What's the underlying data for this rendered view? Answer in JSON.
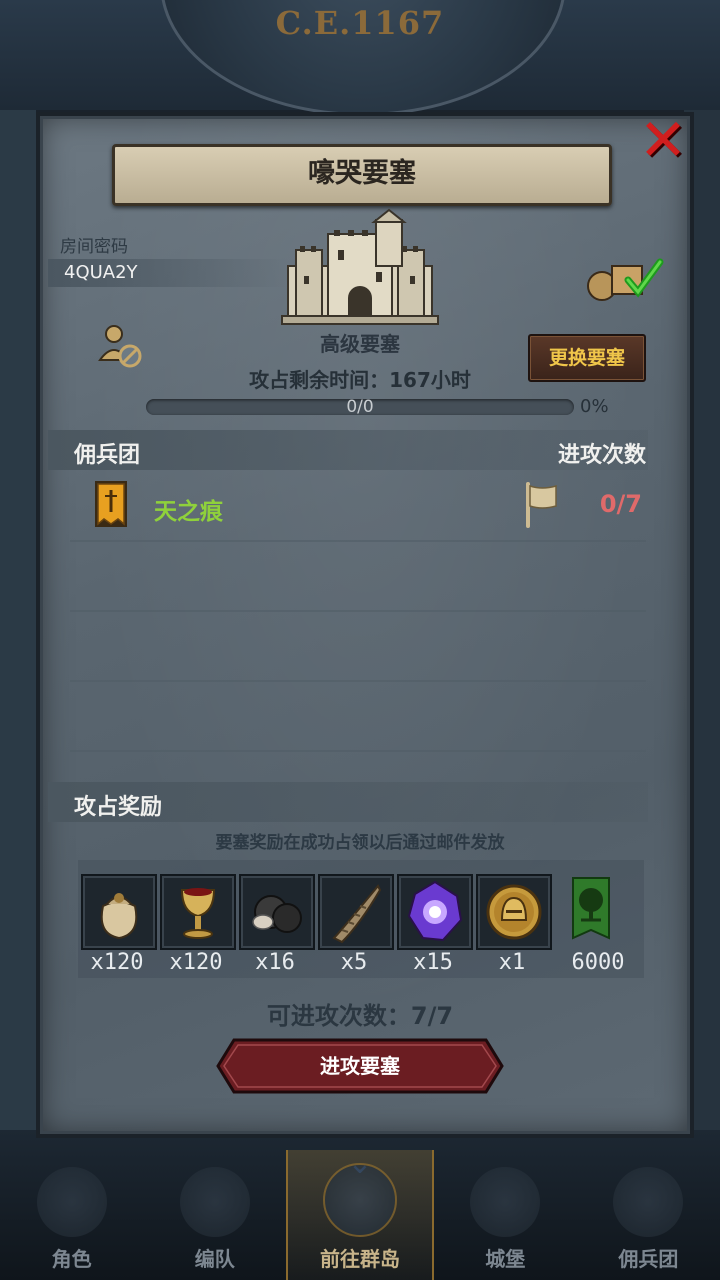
{
  "era": "C.E.1167",
  "dialog": {
    "title": "嚎哭要塞",
    "room_code_label": "房间密码",
    "room_code": "4QUA2Y",
    "fortress_level": "高级要塞",
    "change_button": "更换要塞",
    "remaining_time": "攻占剩余时间：167小时",
    "progress_text": "0/0",
    "progress_percent": "0%",
    "progress_value": 0,
    "mercenary_header": "佣兵团",
    "attacks_header": "进攻次数",
    "mercenaries": [
      {
        "name": "天之痕",
        "attacks": "0/7"
      }
    ],
    "rewards_header": "攻占奖励",
    "reward_note": "要塞奖励在成功占领以后通过邮件发放",
    "rewards": [
      {
        "icon": "sack-icon",
        "qty": "x120"
      },
      {
        "icon": "goblet-icon",
        "qty": "x120"
      },
      {
        "icon": "ore-icon",
        "qty": "x16"
      },
      {
        "icon": "horn-icon",
        "qty": "x5"
      },
      {
        "icon": "purple-crystal-icon",
        "qty": "x15"
      },
      {
        "icon": "golden-helmet-coin-icon",
        "qty": "x1"
      },
      {
        "icon": "tree-banner-icon",
        "qty": "6000"
      }
    ],
    "attacks_available": "可进攻次数：7/7",
    "attack_button": "进攻要塞"
  },
  "nav": [
    {
      "label": "角色",
      "active": false
    },
    {
      "label": "编队",
      "active": false
    },
    {
      "label": "前往群岛",
      "active": true
    },
    {
      "label": "城堡",
      "active": false
    },
    {
      "label": "佣兵团",
      "active": false
    }
  ],
  "colors": {
    "accent_gold": "#f0c64a",
    "mercenary_green": "#8fd13b",
    "attack_count_red": "#e06a6a",
    "close_red": "#d01e1e",
    "button_crimson": "#6b1d22"
  }
}
